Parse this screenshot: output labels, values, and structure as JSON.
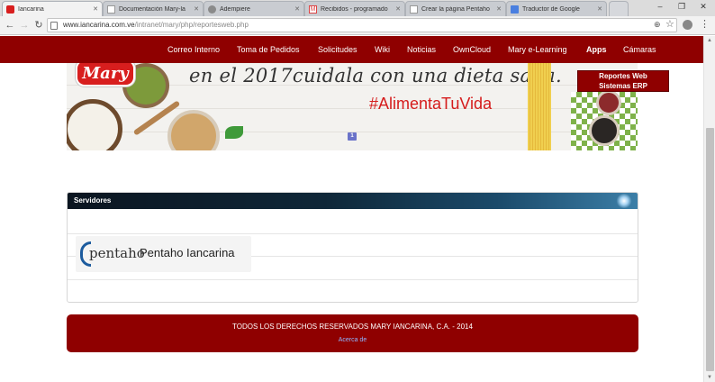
{
  "tabs": [
    {
      "label": "Iancarina",
      "active": true,
      "favicon": "mary-favicon"
    },
    {
      "label": "Documentación Mary-la",
      "active": false,
      "favicon": "doc-favicon"
    },
    {
      "label": "Adempiere",
      "active": false,
      "favicon": "adempiere-favicon"
    },
    {
      "label": "Recibidos - programado",
      "active": false,
      "favicon": "gmail-favicon"
    },
    {
      "label": "Crear la página Pentaho",
      "active": false,
      "favicon": "doc-favicon"
    },
    {
      "label": "Traductor de Google",
      "active": false,
      "favicon": "translate-favicon"
    }
  ],
  "window": {
    "minimize": "–",
    "maximize": "❐",
    "close": "✕"
  },
  "address": {
    "host": "www.iancarina.com.ve",
    "path": "/intranet/mary/php/reportesweb.php"
  },
  "nav": {
    "items": [
      {
        "label": "Correo Interno",
        "bold": false
      },
      {
        "label": "Toma de Pedidos",
        "bold": false
      },
      {
        "label": "Solicitudes",
        "bold": false
      },
      {
        "label": "Wiki",
        "bold": false
      },
      {
        "label": "Noticias",
        "bold": false
      },
      {
        "label": "OwnCloud",
        "bold": false
      },
      {
        "label": "Mary e-Learning",
        "bold": false
      },
      {
        "label": "Apps",
        "bold": true
      },
      {
        "label": "Cámaras",
        "bold": false
      }
    ]
  },
  "banner": {
    "logo": "Mary",
    "slogan": "en el 2017cuidala con una dieta sana.",
    "hashtag": "#AlimentaTuVida",
    "slide": "1"
  },
  "reports_menu": {
    "line1": "Reportes Web",
    "line2": "Sistemas ERP"
  },
  "servers": {
    "title": "Servidores",
    "pentaho_logo_text": "pentaho",
    "pentaho_label": "Pentaho Iancarina"
  },
  "footer": {
    "copyright": "TODOS LOS DERECHOS RESERVADOS MARY IANCARINA, C.A. - 2014",
    "link": "Acerca de"
  },
  "colors": {
    "brand_red": "#8f0000",
    "hashtag_red": "#d51c1c",
    "link": "#8fb5ff"
  }
}
